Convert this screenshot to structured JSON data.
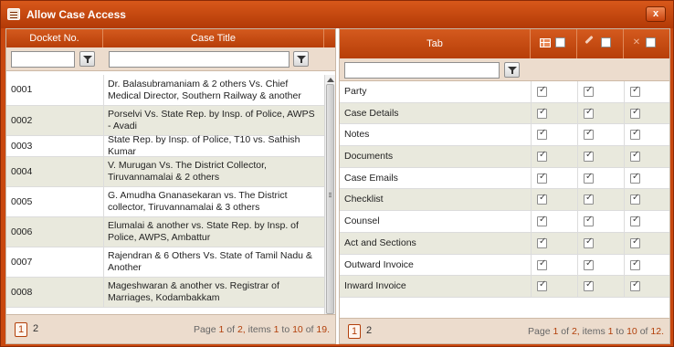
{
  "window": {
    "title": "Allow Case Access",
    "close_label": "x"
  },
  "left_grid": {
    "columns": [
      "Docket No.",
      "Case Title"
    ],
    "rows": [
      {
        "docket": "0001",
        "title": "Dr. Balasubramaniam & 2 others Vs. Chief Medical Director, Southern Railway & another"
      },
      {
        "docket": "0002",
        "title": "Porselvi Vs. State Rep. by Insp. of Police, AWPS - Avadi"
      },
      {
        "docket": "0003",
        "title": "State Rep. by Insp. of Police, T10 vs. Sathish Kumar"
      },
      {
        "docket": "0004",
        "title": "V. Murugan Vs. The District Collector, Tiruvannamalai & 2 others"
      },
      {
        "docket": "0005",
        "title": "G. Amudha Gnanasekaran vs. The District collector, Tiruvannamalai & 3 others"
      },
      {
        "docket": "0006",
        "title": "Elumalai & another vs. State Rep. by Insp. of Police, AWPS, Ambattur"
      },
      {
        "docket": "0007",
        "title": "Rajendran & 6 Others Vs. State of Tamil Nadu & Another"
      },
      {
        "docket": "0008",
        "title": "Mageshwaran & another vs. Registrar of Marriages, Kodambakkam"
      }
    ],
    "pager": {
      "pages": [
        "1",
        "2"
      ],
      "current": "1",
      "prefix": "Page",
      "page": "1",
      "of": "of",
      "total_pages": "2,",
      "items": "items",
      "from": "1",
      "to_word": "to",
      "to": "10",
      "of2": "of",
      "total": "19."
    }
  },
  "right_grid": {
    "column": "Tab",
    "header_icons": [
      "grid-icon",
      "pencil-icon",
      "tools-icon"
    ],
    "rows": [
      {
        "label": "Party",
        "view": true,
        "edit": true,
        "admin": true
      },
      {
        "label": "Case Details",
        "view": true,
        "edit": true,
        "admin": true
      },
      {
        "label": "Notes",
        "view": true,
        "edit": true,
        "admin": true
      },
      {
        "label": "Documents",
        "view": true,
        "edit": true,
        "admin": true
      },
      {
        "label": "Case Emails",
        "view": true,
        "edit": true,
        "admin": true
      },
      {
        "label": "Checklist",
        "view": true,
        "edit": true,
        "admin": true
      },
      {
        "label": "Counsel",
        "view": true,
        "edit": true,
        "admin": true
      },
      {
        "label": "Act and Sections",
        "view": true,
        "edit": true,
        "admin": true
      },
      {
        "label": "Outward Invoice",
        "view": true,
        "edit": true,
        "admin": true
      },
      {
        "label": "Inward Invoice",
        "view": true,
        "edit": true,
        "admin": true
      }
    ],
    "pager": {
      "pages": [
        "1",
        "2"
      ],
      "current": "1",
      "prefix": "Page",
      "page": "1",
      "of": "of",
      "total_pages": "2,",
      "items": "items",
      "from": "1",
      "to_word": "to",
      "to": "10",
      "of2": "of",
      "total": "12."
    }
  },
  "colors": {
    "accent": "#c9480f",
    "header": "#b73e08",
    "alt_row": "#e9e9dd",
    "filter_bg": "#ecdccd"
  }
}
